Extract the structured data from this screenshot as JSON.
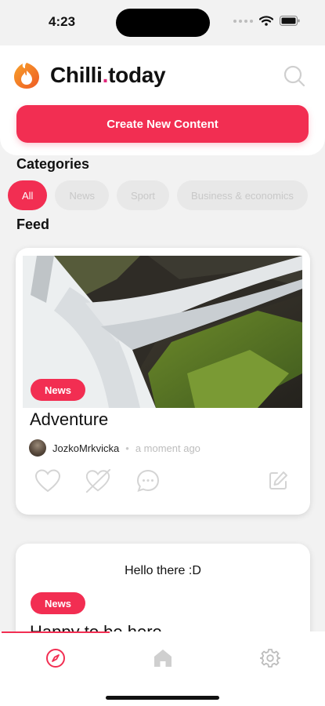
{
  "status_bar": {
    "time": "4:23",
    "icons": [
      "signal-icon",
      "wifi-icon",
      "battery-icon"
    ]
  },
  "header": {
    "brand_main": "Chilli",
    "brand_dot": ".",
    "brand_tail": "today",
    "search_icon": "search-icon",
    "create_button_label": "Create New Content"
  },
  "categories": {
    "title": "Categories",
    "items": [
      {
        "label": "All",
        "active": true
      },
      {
        "label": "News",
        "active": false
      },
      {
        "label": "Sport",
        "active": false
      },
      {
        "label": "Business & economics",
        "active": false
      }
    ]
  },
  "feed": {
    "title": "Feed",
    "posts": [
      {
        "badge": "News",
        "title": "Adventure",
        "author": "JozkoMrkvicka",
        "separator": "•",
        "time": "a moment ago",
        "actions": [
          "heart-icon",
          "broken-heart-icon",
          "comment-icon",
          "edit-icon"
        ]
      },
      {
        "text": "Hello there :D",
        "badge": "News",
        "title": "Happy to be here"
      }
    ]
  },
  "tab_bar": {
    "tabs": [
      {
        "icon": "compass-icon",
        "active": true
      },
      {
        "icon": "home-icon",
        "active": false
      },
      {
        "icon": "settings-icon",
        "active": false
      }
    ]
  },
  "colors": {
    "accent": "#f22e52",
    "logo_orange": "#f58a23",
    "brand_dot": "#e0267a",
    "inactive_chip": "#e8e8e8"
  }
}
